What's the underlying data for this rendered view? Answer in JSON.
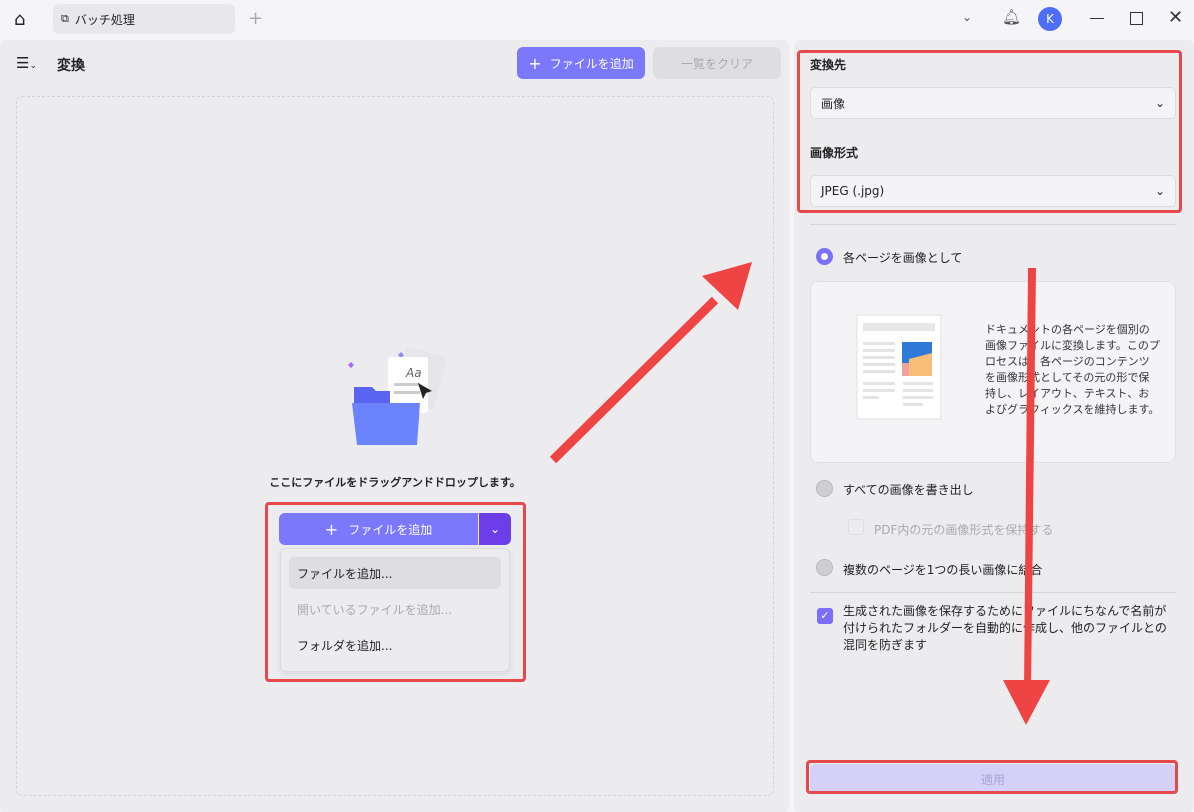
{
  "tab": {
    "title": "バッチ処理"
  },
  "header": {
    "title": "変換",
    "add_files": "ファイルを追加",
    "clear_list": "一覧をクリア"
  },
  "dropzone": {
    "hint": "ここにファイルをドラッグアンドドロップします。",
    "add_files": "ファイルを追加",
    "menu": [
      "ファイルを追加...",
      "開いているファイルを追加...",
      "フォルダを追加..."
    ]
  },
  "user": {
    "avatar": "K"
  },
  "panel": {
    "convert_to_label": "変換先",
    "convert_to_value": "画像",
    "format_label": "画像形式",
    "format_value": "JPEG (.jpg)",
    "opt_each_page": "各ページを画像として",
    "description": "ドキュメントの各ページを個別の画像ファイルに変換します。このプロセスは、各ページのコンテンツを画像形式としてその元の形で保持し、レイアウト、テキスト、およびグラフィックスを維持します。",
    "opt_extract": "すべての画像を書き出し",
    "opt_keep_format": "PDF内の元の画像形式を保持する",
    "opt_merge": "複数のページを1つの長い画像に結合",
    "auto_folder": "生成された画像を保存するためにファイルにちなんで名前が付けられたフォルダーを自動的に作成し、他のファイルとの混同を防ぎます",
    "apply": "適用"
  },
  "colors": {
    "accent": "#7c6ff7",
    "annotation": "#e5484d"
  }
}
